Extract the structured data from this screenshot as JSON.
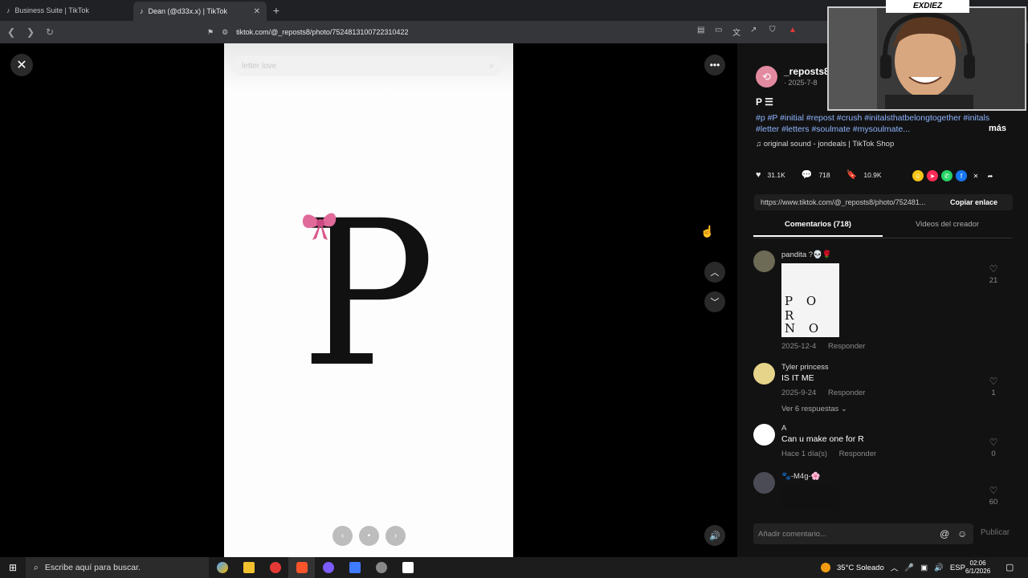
{
  "browser": {
    "tabs": [
      {
        "label": "Business Suite | TikTok",
        "icon": "tiktok-icon"
      },
      {
        "label": "Dean (@d33x.x) | TikTok",
        "icon": "tiktok-icon",
        "close": "✕"
      }
    ],
    "new_tab": "+",
    "url": "tiktok.com/@_reposts8/photo/7524813100722310422"
  },
  "viewer": {
    "search_placeholder": "letter love",
    "letter": "P",
    "close_label": "✕",
    "more_label": "•••",
    "up_label": "︿",
    "down_label": "﹀",
    "carousel": [
      "‹",
      "•",
      "›"
    ]
  },
  "post": {
    "author": "_reposts8",
    "date": "· 2025-7-8",
    "caption": "P ☰",
    "tags": "#p #P #initial #repost #crush #initalsthatbelongtogether #initals #letter #letters #soulmate #mysoulmate...",
    "more": "más",
    "sound": "original sound - jondeals | TikTok Shop",
    "likes": "31.1K",
    "comments": "718",
    "saves": "10.9K",
    "link": "https://www.tiktok.com/@_reposts8/photo/752481...",
    "copy_label": "Copiar enlace",
    "tab_comments": "Comentarios (718)",
    "tab_creator": "Videos del creador"
  },
  "comments": [
    {
      "name": "pandita ?💀🌹",
      "text": "",
      "date": "2025-12-4",
      "reply": "Responder",
      "likes": "21",
      "image_rows": [
        "P O R",
        "N O"
      ]
    },
    {
      "name": "Tyler princess",
      "text": "IS IT ME",
      "date": "2025-9-24",
      "reply": "Responder",
      "likes": "1",
      "replies": "Ver 6 respuestas ⌄"
    },
    {
      "name": "A",
      "text": "Can u make one for R",
      "date": "Hace 1 día(s)",
      "reply": "Responder",
      "likes": "0"
    },
    {
      "name": "🐾-M4g-🌸",
      "text": "",
      "likes": "60"
    }
  ],
  "composer": {
    "placeholder": "Añadir comentario...",
    "post": "Publicar"
  },
  "webcam": {
    "label": "EXDIEZ"
  },
  "taskbar": {
    "search": "Escribe aquí para buscar.",
    "weather": "35°C  Soleado",
    "lang": "ESP",
    "time": "02:06",
    "date": "6/1/2026"
  }
}
